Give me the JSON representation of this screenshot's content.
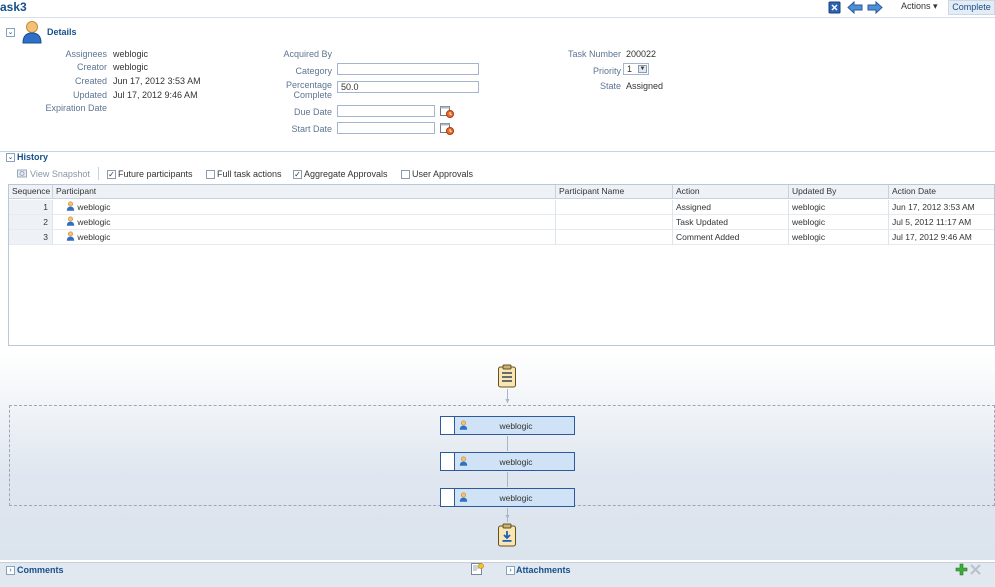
{
  "title": "ask3",
  "toolbar": {
    "actions_label": "Actions ▾",
    "complete_label": "Complete"
  },
  "details": {
    "header": "Details",
    "col1": {
      "assignees_label": "Assignees",
      "assignees_value": "weblogic",
      "creator_label": "Creator",
      "creator_value": "weblogic",
      "created_label": "Created",
      "created_value": "Jun 17, 2012 3:53 AM",
      "updated_label": "Updated",
      "updated_value": "Jul 17, 2012 9:46 AM",
      "expiration_label": "Expiration Date"
    },
    "col2": {
      "acquired_label": "Acquired By",
      "category_label": "Category",
      "category_value": "",
      "percentage_label_1": "Percentage",
      "percentage_label_2": "Complete",
      "percentage_value": "50.0",
      "due_label": "Due Date",
      "due_value": "",
      "start_label": "Start Date",
      "start_value": ""
    },
    "col3": {
      "task_number_label": "Task Number",
      "task_number_value": "200022",
      "priority_label": "Priority",
      "priority_value": "1",
      "state_label": "State",
      "state_value": "Assigned"
    }
  },
  "history": {
    "header": "History",
    "view_snapshot": "View Snapshot",
    "future_participants": "Future participants",
    "full_task_actions": "Full task actions",
    "aggregate_approvals": "Aggregate Approvals",
    "user_approvals": "User Approvals",
    "columns": [
      "Sequence",
      "Participant",
      "Participant Name",
      "Action",
      "Updated By",
      "Action Date"
    ],
    "rows": [
      {
        "seq": "1",
        "participant": "weblogic",
        "name": "",
        "action": "Assigned",
        "updated_by": "weblogic",
        "date": "Jun 17, 2012 3:53 AM"
      },
      {
        "seq": "2",
        "participant": "weblogic",
        "name": "",
        "action": "Task Updated",
        "updated_by": "weblogic",
        "date": "Jul 5, 2012 11:17 AM"
      },
      {
        "seq": "3",
        "participant": "weblogic",
        "name": "",
        "action": "Comment Added",
        "updated_by": "weblogic",
        "date": "Jul 17, 2012 9:46 AM"
      }
    ]
  },
  "diagram": {
    "nodes": [
      "weblogic",
      "weblogic",
      "weblogic"
    ]
  },
  "bottom": {
    "comments": "Comments",
    "attachments": "Attachments"
  },
  "colors": {
    "header_blue": "#16508a",
    "node_fill": "#cfe2f6",
    "node_border": "#2c5a9b"
  }
}
